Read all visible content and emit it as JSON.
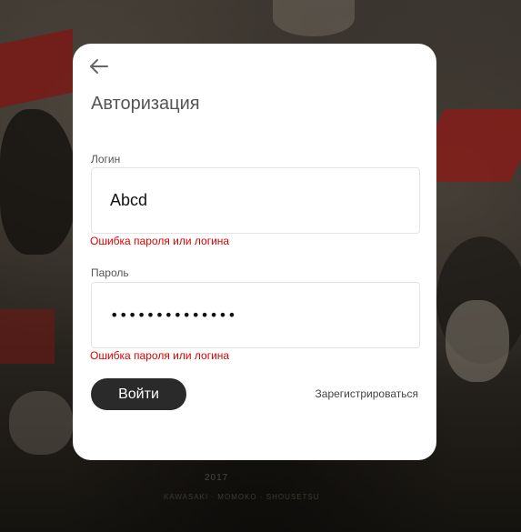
{
  "background": {
    "caption": "2017",
    "caption2": "KAWASAKI · MOMOKO · SHOUSETSU"
  },
  "form": {
    "title": "Авторизация",
    "login": {
      "label": "Логин",
      "value": "Abcd",
      "error": "Ошибка пароля или логина"
    },
    "password": {
      "label": "Пароль",
      "masked_value": "••••••••••••••",
      "error": "Ошибка пароля или логина"
    },
    "submit_label": "Войти",
    "register_label": "Зарегистрироваться"
  },
  "colors": {
    "error": "#e00000",
    "button": "#2a2a2a",
    "card": "#ffffff"
  },
  "icons": {
    "back": "arrow-left-icon"
  }
}
